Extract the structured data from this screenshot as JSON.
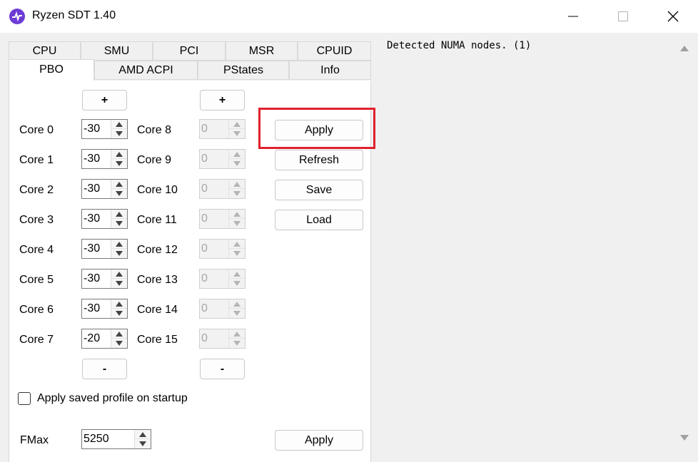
{
  "window": {
    "title": "Ryzen SDT 1.40",
    "icon": "app-pulse-icon",
    "controls": [
      "minimize-icon",
      "maximize-icon",
      "close-icon"
    ]
  },
  "tabs": {
    "row1": [
      "CPU",
      "SMU",
      "PCI",
      "MSR",
      "CPUID"
    ],
    "row2": [
      "PBO",
      "AMD ACPI",
      "PStates",
      "Info"
    ],
    "selected": "PBO"
  },
  "pbo": {
    "plus_label": "+",
    "minus_label": "-",
    "cores_left": [
      {
        "label": "Core 0",
        "value": "-30"
      },
      {
        "label": "Core 1",
        "value": "-30"
      },
      {
        "label": "Core 2",
        "value": "-30"
      },
      {
        "label": "Core 3",
        "value": "-30"
      },
      {
        "label": "Core 4",
        "value": "-30"
      },
      {
        "label": "Core 5",
        "value": "-30"
      },
      {
        "label": "Core 6",
        "value": "-30"
      },
      {
        "label": "Core 7",
        "value": "-20"
      }
    ],
    "cores_right": [
      {
        "label": "Core 8",
        "value": "0"
      },
      {
        "label": "Core 9",
        "value": "0"
      },
      {
        "label": "Core 10",
        "value": "0"
      },
      {
        "label": "Core 11",
        "value": "0"
      },
      {
        "label": "Core 12",
        "value": "0"
      },
      {
        "label": "Core 13",
        "value": "0"
      },
      {
        "label": "Core 14",
        "value": "0"
      },
      {
        "label": "Core 15",
        "value": "0"
      }
    ],
    "actions": {
      "apply": "Apply",
      "refresh": "Refresh",
      "save": "Save",
      "load": "Load"
    },
    "startup_checkbox": {
      "label": "Apply saved profile on startup",
      "checked": false
    },
    "fmax": {
      "label": "FMax",
      "value": "5250",
      "apply": "Apply"
    }
  },
  "log": {
    "text": "Detected NUMA nodes. (1)"
  },
  "colors": {
    "highlight": "#e0202c",
    "app_icon": "#6d3bd6"
  }
}
